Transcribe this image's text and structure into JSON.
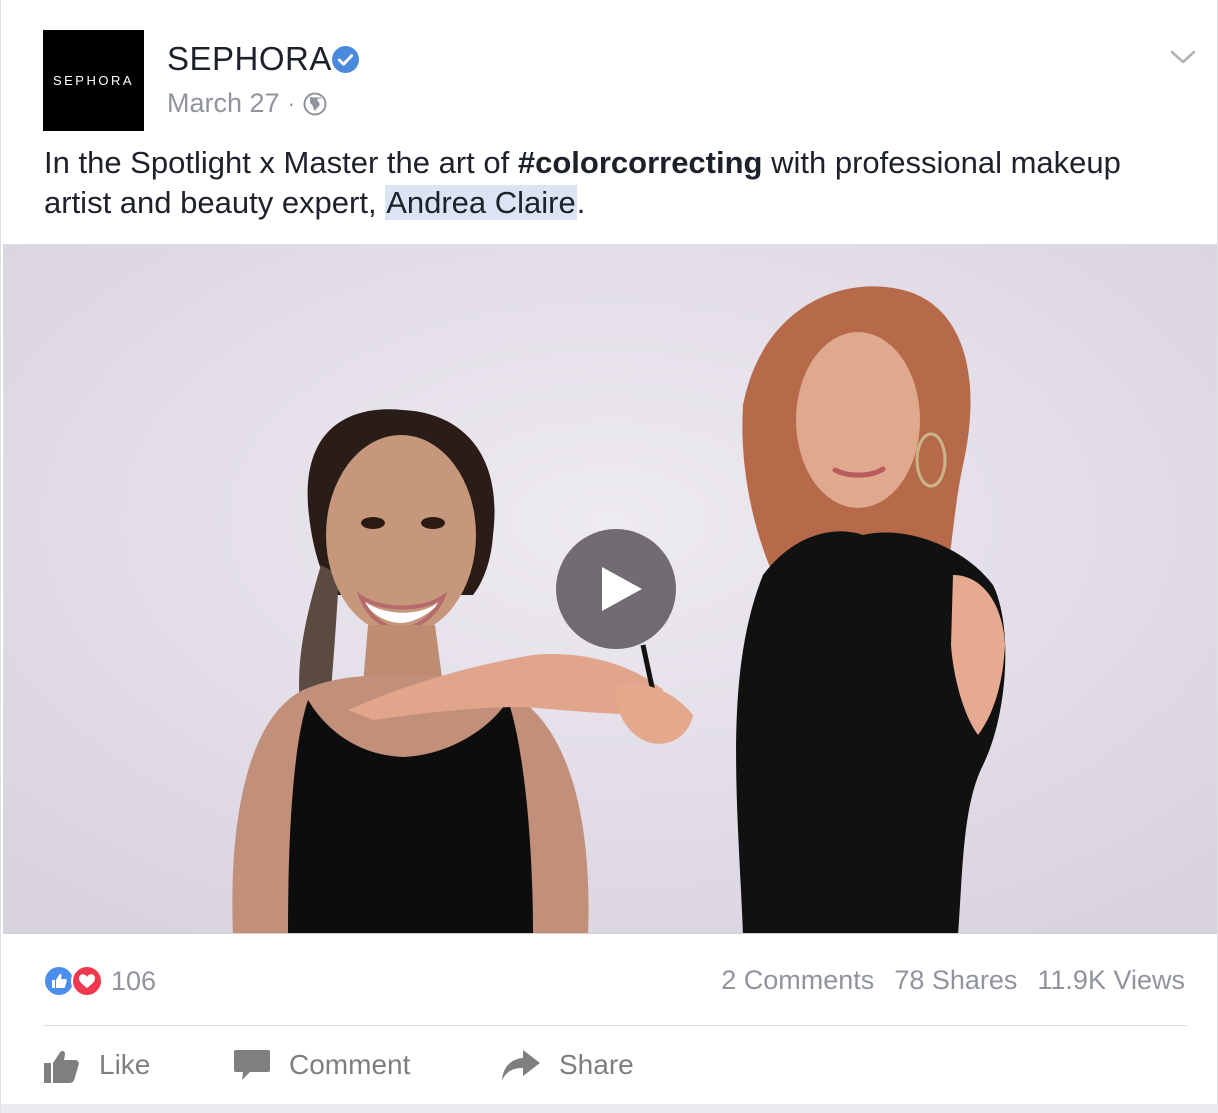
{
  "post": {
    "logo_text": "SEPHORA",
    "page_name": "SEPHORA",
    "timestamp": "March 27",
    "separator": "·",
    "text_before": "In the Spotlight x Master the art of ",
    "hashtag": "#colorcorrecting",
    "text_middle": " with professional makeup artist and beauty expert, ",
    "mention": "Andrea Claire",
    "text_after": "."
  },
  "stats": {
    "reaction_count": "106",
    "comments": "2 Comments",
    "shares": "78 Shares",
    "views": "11.9K Views"
  },
  "actions": {
    "like": "Like",
    "comment": "Comment",
    "share": "Share"
  },
  "icons": {
    "verified": "verified-badge-icon",
    "audience": "globe-icon",
    "menu": "chevron-down-icon",
    "play": "play-icon",
    "like_reaction": "like-reaction-icon",
    "love_reaction": "love-reaction-icon"
  },
  "colors": {
    "verified_blue": "#4a89dc",
    "like_blue": "#4b8ef0",
    "love_red": "#f0394f",
    "mention_highlight": "#dce4f4"
  }
}
